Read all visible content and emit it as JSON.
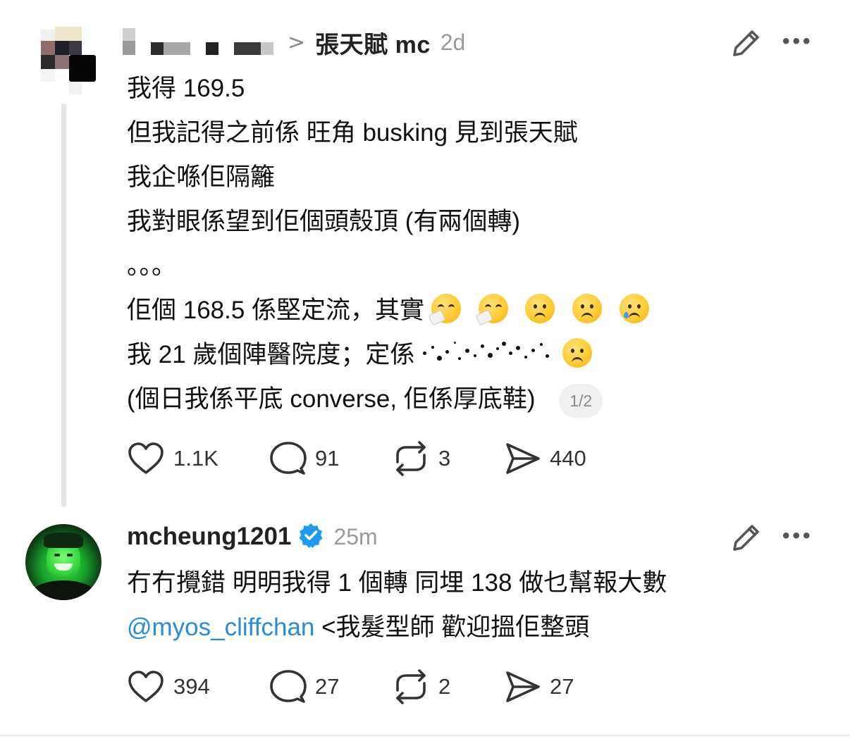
{
  "post1": {
    "reply_to_chevron": ">",
    "reply_to_name": "張天賦 mc",
    "age": "2d",
    "lines": [
      "我得 169.5",
      "但我記得之前係 旺角 busking 見到張天賦",
      "我企喺佢隔籬",
      "我對眼係望到佢個頭殼頂 (有兩個轉)",
      "。。。",
      "佢個 168.5 係堅定流，其實",
      "我 21 歲個陣醫院度；定係",
      "(個日我係平底 converse, 佢係厚底鞋)"
    ],
    "line6_emojis": [
      "sneezing-face",
      "sneezing-face",
      "frowning-face",
      "frowning-face",
      "crying-face"
    ],
    "line7_emojis": [
      "frowning-face"
    ],
    "page_indicator": "1/2",
    "actions": {
      "likes": "1.1K",
      "comments": "91",
      "reposts": "3",
      "shares": "440"
    }
  },
  "post2": {
    "handle": "mcheung1201",
    "verified": true,
    "age": "25m",
    "line1": "冇冇攪錯 明明我得 1 個轉 同埋 138 做乜幫報大數",
    "mention": "@myos_cliffchan",
    "line2_rest": " <我髮型師 歡迎搵佢整頭",
    "actions": {
      "likes": "394",
      "comments": "27",
      "reposts": "2",
      "shares": "27"
    }
  },
  "colors": {
    "accent_link": "#2a8bd6",
    "verified_badge": "#1d9bf0",
    "muted_text": "#9a9a9a",
    "thread_line": "#e4e4e4"
  },
  "icons": [
    "pencil-icon",
    "more-icon",
    "heart-icon",
    "comment-icon",
    "repost-icon",
    "share-icon",
    "verified-icon",
    "chevron-right-icon"
  ]
}
